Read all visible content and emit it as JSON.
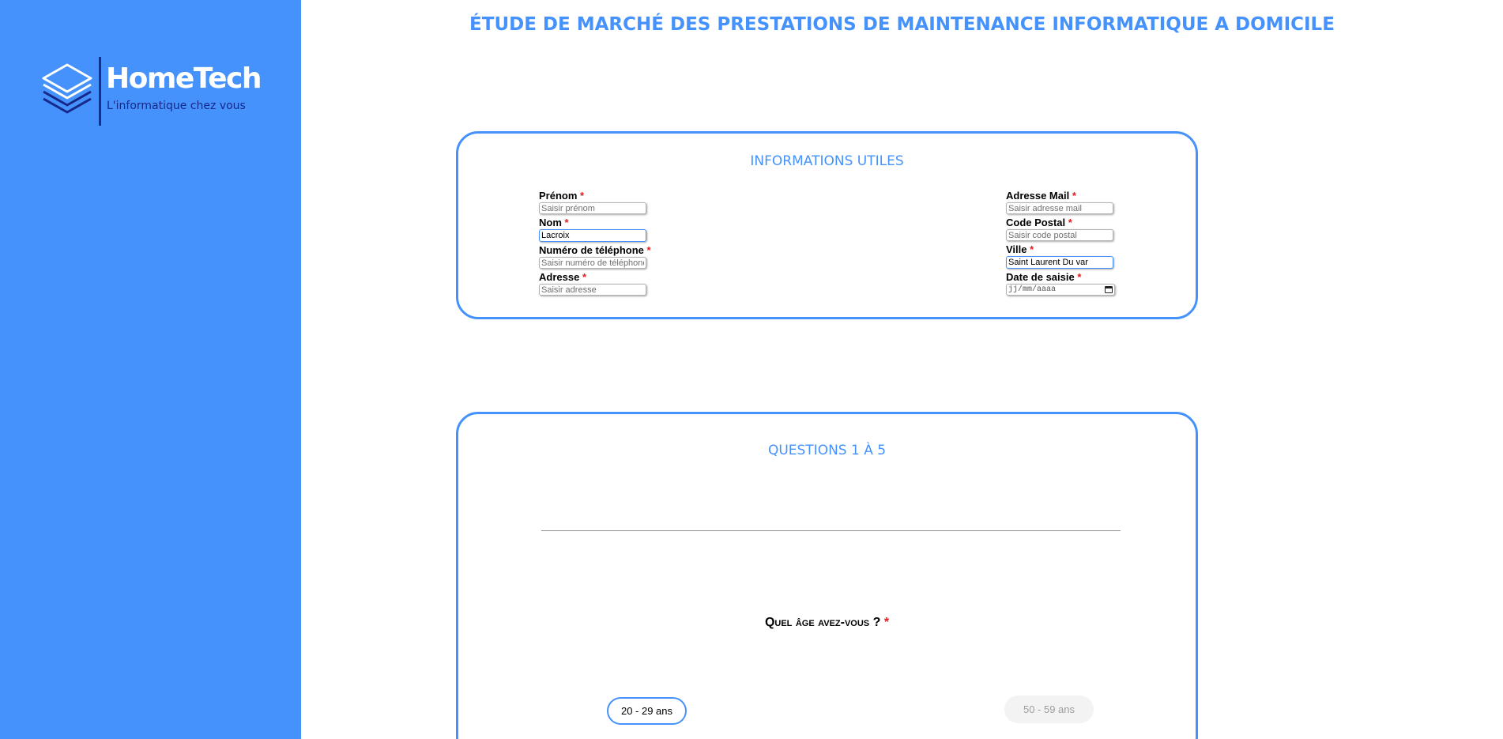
{
  "brand": {
    "name": "HomeTech",
    "tagline": "L'informatique chez vous",
    "colors": {
      "accent": "#4592fd",
      "tagline": "#16288a",
      "required": "#e21c1c"
    }
  },
  "page_title": "ÉTUDE DE MARCHÉ DES PRESTATIONS DE MAINTENANCE INFORMATIQUE A DOMICILE",
  "info_section": {
    "title": "INFORMATIONS UTILES",
    "required_mark": "*",
    "fields": {
      "prenom": {
        "label": "Prénom",
        "placeholder": "Saisir prénom",
        "value": ""
      },
      "nom": {
        "label": "Nom",
        "placeholder": "",
        "value": "Lacroix"
      },
      "telephone": {
        "label": "Numéro de téléphone",
        "placeholder": "Saisir numéro de téléphone",
        "value": ""
      },
      "adresse": {
        "label": "Adresse",
        "placeholder": "Saisir adresse",
        "value": ""
      },
      "mail": {
        "label": "Adresse Mail",
        "placeholder": "Saisir adresse mail",
        "value": ""
      },
      "code_postal": {
        "label": "Code Postal",
        "placeholder": "Saisir code postal",
        "value": ""
      },
      "ville": {
        "label": "Ville",
        "placeholder": "",
        "value": "Saint Laurent Du var"
      },
      "date": {
        "label": "Date de saisie",
        "placeholder": "jj/mm/aaaa",
        "icon": "calendar-icon"
      }
    }
  },
  "questions_section": {
    "title": "QUESTIONS 1 À 5",
    "question": "Quel âge avez-vous ?",
    "required_mark": "*",
    "options": [
      {
        "label": "20 - 29 ans",
        "selected": true
      },
      {
        "label": "50 - 59 ans",
        "selected": false
      }
    ]
  }
}
